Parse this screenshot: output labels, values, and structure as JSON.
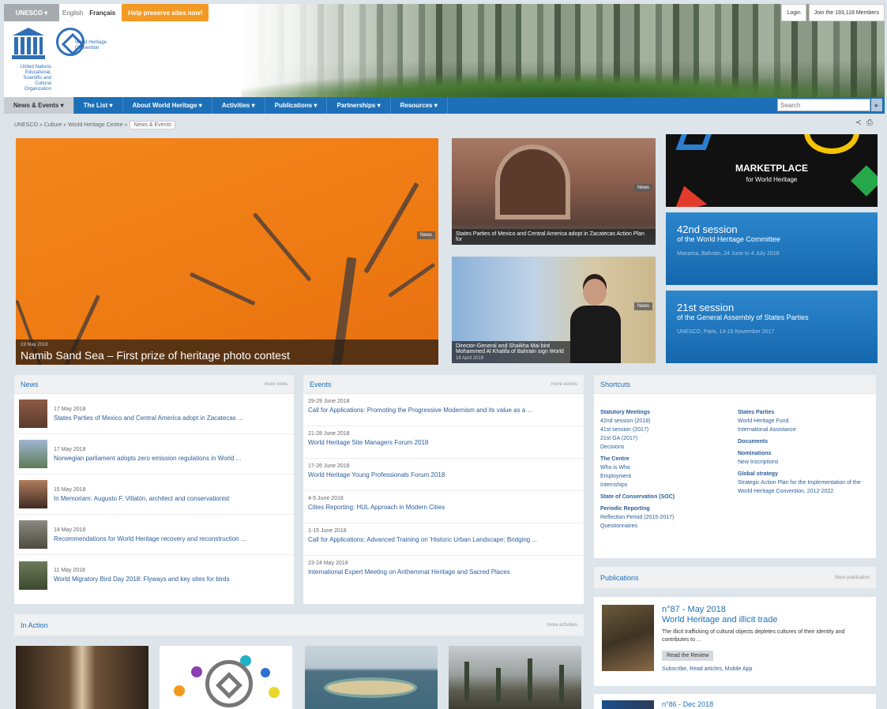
{
  "top": {
    "unesco_label": "UNESCO ▾",
    "lang_en": "English",
    "lang_fr": "Français",
    "help_btn": "Help preserve sites now!",
    "login": "Login",
    "join": "Join the 193,118 Members",
    "logo_unesco": "United Nations Educational, Scientific and Cultural Organization",
    "logo_whc": "World Heritage Convention"
  },
  "nav": {
    "items": [
      "News & Events ▾",
      "The List ▾",
      "About World Heritage ▾",
      "Activities ▾",
      "Publications ▾",
      "Partnerships ▾",
      "Resources ▾"
    ],
    "search_placeholder": "Search",
    "search_icon": "▸"
  },
  "breadcrumb": {
    "path": "UNESCO » Culture » World Heritage Centre »",
    "current": "News & Events"
  },
  "tools": {
    "share": "≺",
    "print": "⎙"
  },
  "featured": {
    "main": {
      "date": "19 May 2018",
      "title": "Namib Sand Sea – First prize of heritage photo contest",
      "tag": "News"
    },
    "second": {
      "title": "States Parties of Mexico and Central America adopt in Zacatecas Action Plan for",
      "tag": "News"
    },
    "third": {
      "title": "Director-General and Shaikha Mai bint Mohammed Al Khalifa of Bahrain sign World",
      "date": "18 April 2018",
      "tag": "News"
    }
  },
  "marketplace": {
    "title": "MARKETPLACE",
    "subtitle": "for World Heritage"
  },
  "session42": {
    "big": "42nd session",
    "mid": "of the World Heritage Committee",
    "sm": "Manama, Bahrain, 24 June to 4 July 2018"
  },
  "session21": {
    "big": "21st session",
    "mid": "of the General Assembly of States Parties",
    "sm": "UNESCO, Paris, 14-15 November 2017"
  },
  "news": {
    "title": "News",
    "more": "more news",
    "items": [
      {
        "date": "17 May 2018",
        "title": "States Parties of Mexico and Central America adopt in Zacatecas ..."
      },
      {
        "date": "17 May 2018",
        "title": "Norwegian parliament adopts zero emission regulations in World ..."
      },
      {
        "date": "15 May 2018",
        "title": "In Memoriam: Augusto F. Villalón, architect and conservationist"
      },
      {
        "date": "14 May 2018",
        "title": "Recommendations for World Heritage recovery and reconstruction ..."
      },
      {
        "date": "11 May 2018",
        "title": "World Migratory Bird Day 2018: Flyways and key sites for birds"
      }
    ]
  },
  "events": {
    "title": "Events",
    "more": "more events",
    "items": [
      {
        "date": "29-29 June 2018",
        "title": "Call for Applications: Promoting the Progressive Modernism and its value as a ..."
      },
      {
        "date": "21-28 June 2018",
        "title": "World Heritage Site Managers Forum 2018"
      },
      {
        "date": "17-26 June 2018",
        "title": "World Heritage Young Professionals Forum 2018"
      },
      {
        "date": "4-5 June 2018",
        "title": "Cities Reporting: HUL Approach in Modern Cities"
      },
      {
        "date": "1-15 June 2018",
        "title": "Call for Applications: Advanced Training on 'Historic Urban Landscape: Bridging ..."
      },
      {
        "date": "23-24 May 2018",
        "title": "International Expert Meeting on Anthemmat Heritage and Sacred Places"
      }
    ]
  },
  "shortcuts": {
    "title": "Shortcuts",
    "left": [
      {
        "g": "Statutory Meetings"
      },
      {
        "l": "42nd session (2018)"
      },
      {
        "l": "41st session (2017)"
      },
      {
        "l": "21st GA (2017)"
      },
      {
        "l": "Decisions"
      },
      {
        "g": "The Centre"
      },
      {
        "l": "Who is Who"
      },
      {
        "l": "Employment"
      },
      {
        "l": "Internships"
      },
      {
        "g": "State of Conservation (SOC)"
      },
      {
        "g": "Periodic Reporting"
      },
      {
        "l": "Reflection Period (2015-2017)"
      },
      {
        "l": "Questionnaires"
      }
    ],
    "right": [
      {
        "g": "States Parties"
      },
      {
        "l": "World Heritage Fund"
      },
      {
        "l": "International Assistance"
      },
      {
        "g": "Documents"
      },
      {
        "g": "Nominations"
      },
      {
        "l": "New Inscriptions"
      },
      {
        "g": "Global strategy"
      },
      {
        "l": "Strategic Action Plan for the Implementation of the World Heritage Convention, 2012-2022"
      }
    ]
  },
  "publications": {
    "title": "Publications",
    "more": "More publication",
    "issue": "n°87 - May 2018",
    "subtitle": "World Heritage and illicit trade",
    "desc": "The illicit trafficking of cultural objects depletes cultures of their identity and contributes to ...",
    "btn": "Read the Review",
    "links": "Subscribe, Read articles, Mobile App",
    "next_issue": "n°86 - Dec 2018"
  },
  "action": {
    "title": "In Action",
    "more": "more activities"
  }
}
